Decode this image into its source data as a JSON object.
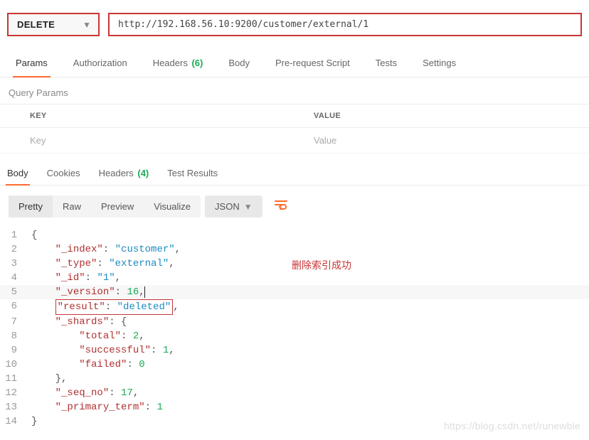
{
  "request": {
    "method": "DELETE",
    "url": "http://192.168.56.10:9200/customer/external/1"
  },
  "tabs": {
    "params": "Params",
    "authorization": "Authorization",
    "headers": "Headers",
    "headers_count": "(6)",
    "body": "Body",
    "prerequest": "Pre-request Script",
    "tests": "Tests",
    "settings": "Settings"
  },
  "params_section": {
    "title": "Query Params",
    "col_key": "KEY",
    "col_value": "VALUE",
    "key_placeholder": "Key",
    "value_placeholder": "Value"
  },
  "resp_tabs": {
    "body": "Body",
    "cookies": "Cookies",
    "headers": "Headers",
    "headers_count": "(4)",
    "test_results": "Test Results"
  },
  "toolbar": {
    "pretty": "Pretty",
    "raw": "Raw",
    "preview": "Preview",
    "visualize": "Visualize",
    "format": "JSON"
  },
  "response_json": {
    "_index": "customer",
    "_type": "external",
    "_id": "1",
    "_version": 16,
    "result": "deleted",
    "_shards": {
      "total": 2,
      "successful": 1,
      "failed": 0
    },
    "_seq_no": 17,
    "_primary_term": 1
  },
  "annotation": "删除索引成功",
  "watermark": "https://blog.csdn.net/runewbie"
}
